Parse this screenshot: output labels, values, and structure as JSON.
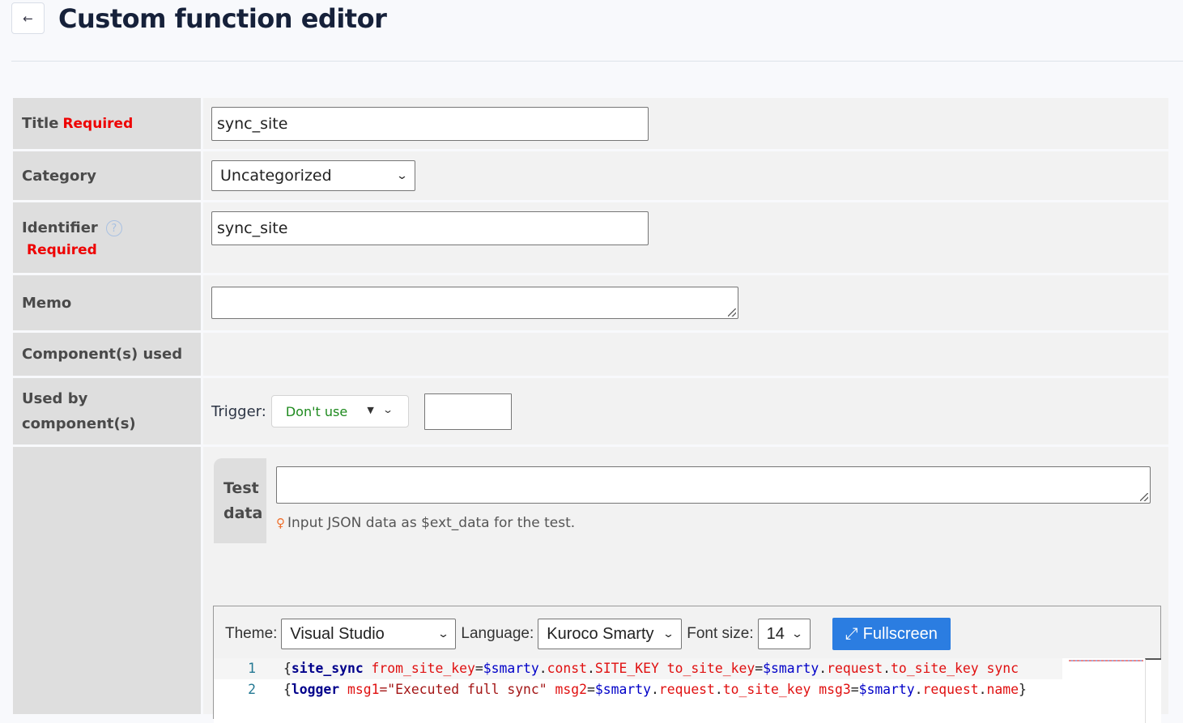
{
  "header": {
    "back_icon": "←",
    "title": "Custom function editor"
  },
  "form": {
    "title": {
      "label": "Title",
      "required": "Required",
      "value": "sync_site"
    },
    "category": {
      "label": "Category",
      "value": "Uncategorized"
    },
    "identifier": {
      "label": "Identifier",
      "help_icon": "?",
      "required": "Required",
      "value": "sync_site"
    },
    "memo": {
      "label": "Memo",
      "value": ""
    },
    "components_used": {
      "label": "Component(s) used"
    },
    "used_by": {
      "label_line1": "Used by",
      "label_line2": "component(s)",
      "trigger_label": "Trigger:",
      "trigger_value": "Don't use",
      "caret_icon": "▼",
      "chevron_icon": "⌄",
      "extra_value": ""
    },
    "test_data": {
      "label_line1": "Test",
      "label_line2": "data",
      "value": "",
      "hint_icon": "💡",
      "hint": "Input JSON data as $ext_data for the test."
    }
  },
  "editor": {
    "theme_label": "Theme:",
    "theme_value": "Visual Studio",
    "language_label": "Language:",
    "language_value": "Kuroco Smarty",
    "font_size_label": "Font size:",
    "font_size_value": "14",
    "fullscreen_icon": "⤢",
    "fullscreen_label": "Fullscreen",
    "lines": [
      {
        "number": "1",
        "tokens": [
          {
            "t": "{",
            "c": "plain"
          },
          {
            "t": "site_sync",
            "c": "kw"
          },
          {
            "t": " from_site_key",
            "c": "attr"
          },
          {
            "t": "=",
            "c": "plain"
          },
          {
            "t": "$smarty",
            "c": "var"
          },
          {
            "t": ".",
            "c": "plain"
          },
          {
            "t": "const",
            "c": "attr"
          },
          {
            "t": ".",
            "c": "plain"
          },
          {
            "t": "SITE_KEY",
            "c": "attr"
          },
          {
            "t": " to_site_key",
            "c": "attr"
          },
          {
            "t": "=",
            "c": "plain"
          },
          {
            "t": "$smarty",
            "c": "var"
          },
          {
            "t": ".",
            "c": "plain"
          },
          {
            "t": "request",
            "c": "attr"
          },
          {
            "t": ".",
            "c": "plain"
          },
          {
            "t": "to_site_key",
            "c": "attr"
          },
          {
            "t": "  sync",
            "c": "attr"
          }
        ]
      },
      {
        "number": "2",
        "tokens": [
          {
            "t": "{",
            "c": "plain"
          },
          {
            "t": "logger",
            "c": "kw"
          },
          {
            "t": " msg1",
            "c": "attr"
          },
          {
            "t": "=\"Executed full sync\"",
            "c": "str"
          },
          {
            "t": " msg2",
            "c": "attr"
          },
          {
            "t": "=",
            "c": "plain"
          },
          {
            "t": "$smarty",
            "c": "var"
          },
          {
            "t": ".",
            "c": "plain"
          },
          {
            "t": "request",
            "c": "attr"
          },
          {
            "t": ".",
            "c": "plain"
          },
          {
            "t": "to_site_key",
            "c": "attr"
          },
          {
            "t": " msg3",
            "c": "attr"
          },
          {
            "t": "=",
            "c": "plain"
          },
          {
            "t": "$smarty",
            "c": "var"
          },
          {
            "t": ".",
            "c": "plain"
          },
          {
            "t": "request",
            "c": "attr"
          },
          {
            "t": ".",
            "c": "plain"
          },
          {
            "t": "name",
            "c": "attr"
          },
          {
            "t": "}",
            "c": "plain"
          }
        ]
      }
    ]
  }
}
